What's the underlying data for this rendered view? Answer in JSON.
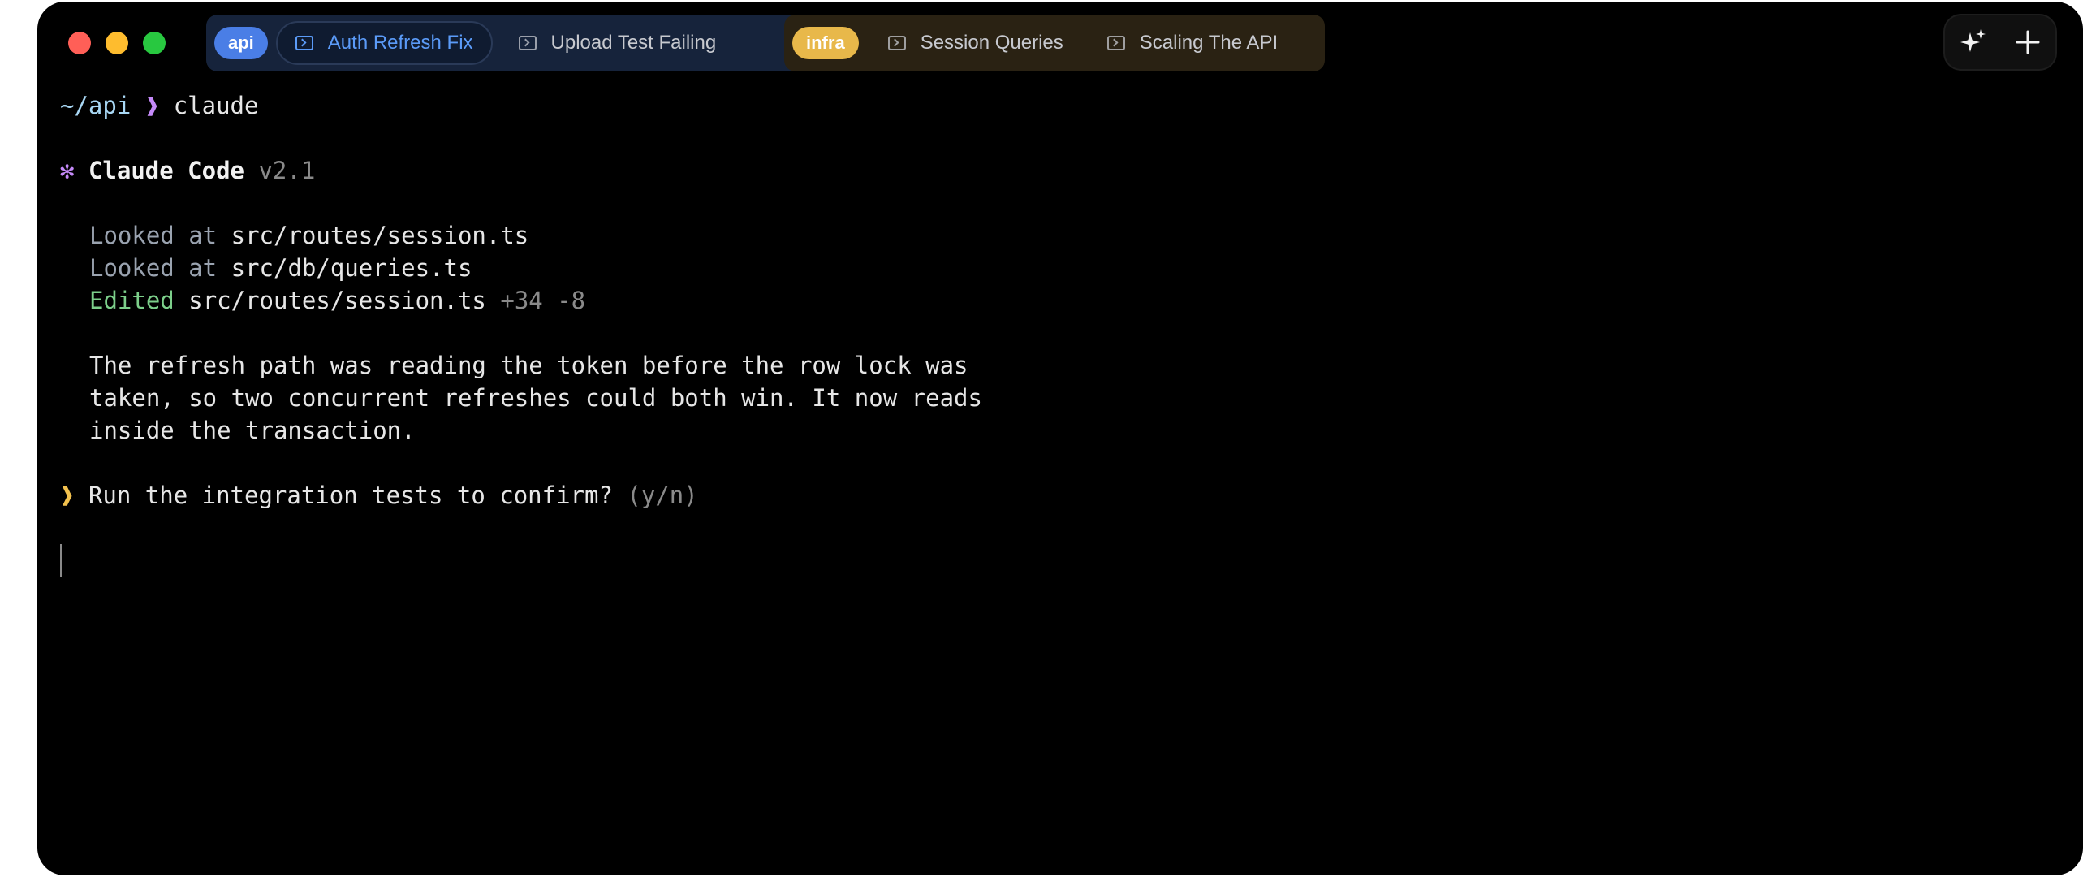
{
  "tabs": {
    "groups": [
      {
        "badge": "api",
        "tabs": [
          {
            "label": "Auth Refresh Fix",
            "active": true
          },
          {
            "label": "Upload Test Failing",
            "active": false
          }
        ]
      },
      {
        "badge": "infra",
        "tabs": [
          {
            "label": "Session Queries",
            "active": false
          },
          {
            "label": "Scaling The API",
            "active": false
          }
        ]
      }
    ]
  },
  "actions": {
    "sparkle_icon": "sparkle-icon",
    "plus_icon": "plus-icon"
  },
  "terminal": {
    "prompt_path": "~/api",
    "prompt_symbol": "❱",
    "command": "claude",
    "app_star": "✻",
    "app_name": "Claude Code",
    "app_version": "v2.1",
    "activity": [
      {
        "verb": "Looked at",
        "path": "src/routes/session.ts",
        "diff": ""
      },
      {
        "verb": "Looked at",
        "path": "src/db/queries.ts",
        "diff": ""
      },
      {
        "verb": "Edited",
        "path": "src/routes/session.ts",
        "diff": "+34 -8"
      }
    ],
    "message_lines": [
      "The refresh path was reading the token before the row lock was",
      "taken, so two concurrent refreshes could both win. It now reads",
      "inside the transaction."
    ],
    "question_symbol": "❱",
    "question": "Run the integration tests to confirm?",
    "question_hint": "(y/n)"
  },
  "colors": {
    "api_badge": "#4a7ee6",
    "infra_badge": "#e8b84a",
    "active_tab_text": "#5b9bf8",
    "accent_purple": "#c58af9",
    "edited_green": "#7ccf8a",
    "question_yellow": "#f2c14e"
  }
}
